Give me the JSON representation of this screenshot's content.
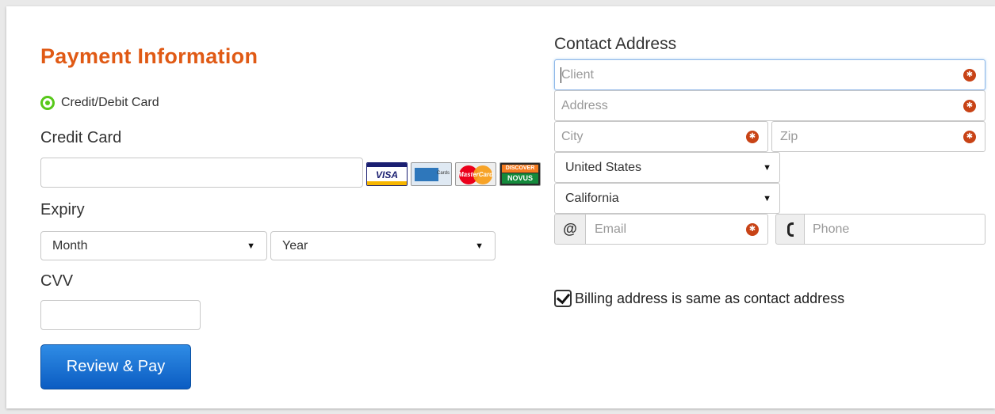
{
  "payment": {
    "title": "Payment Information",
    "method_label": "Credit/Debit Card",
    "credit_card_label": "Credit Card",
    "card_number_value": "",
    "card_logos": [
      "visa-logo",
      "amex-logo",
      "mastercard-logo",
      "discover-novus-logo"
    ],
    "visa_text": "VISA",
    "amex_text": "Cards",
    "mastercard_text": "MasterCard",
    "discover_top": "DISCOVER",
    "discover_bottom": "NOVUS",
    "expiry_label": "Expiry",
    "month_selected": "Month",
    "year_selected": "Year",
    "cvv_label": "CVV",
    "cvv_value": "",
    "submit_label": "Review & Pay"
  },
  "contact": {
    "title": "Contact Address",
    "client_placeholder": "Client",
    "address_placeholder": "Address",
    "city_placeholder": "City",
    "zip_placeholder": "Zip",
    "country_selected": "United States",
    "state_selected": "California",
    "email_addon": "@",
    "email_placeholder": "Email",
    "phone_placeholder": "Phone",
    "billing_same_label": "Billing address is same as contact address",
    "billing_same_checked": true
  },
  "colors": {
    "title_accent": "#e05a15",
    "radio_green": "#57c81a",
    "button_blue": "#0b5cc2",
    "required_marker": "#c84316"
  }
}
